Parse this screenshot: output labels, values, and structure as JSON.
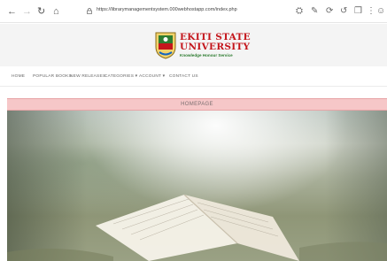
{
  "browser": {
    "url": "https://librarymanagementsystem.000webhostapp.com/index.php",
    "icons": [
      "back-icon",
      "forward-icon",
      "reload-icon",
      "home-icon",
      "lock-icon"
    ],
    "extension_icons": [
      "translate-icon",
      "pen-icon",
      "sync-icon",
      "history-icon",
      "collections-icon",
      "sidebar-icon",
      "profile-icon"
    ]
  },
  "header": {
    "university_line1": "EKITI STATE",
    "university_line2": "UNIVERSITY",
    "motto": "Knowledge Honour Service"
  },
  "menu": {
    "items": [
      "HOME",
      "POPULAR BOOKS",
      "NEW RELEASES",
      "CATEGORIES ▾",
      "ACCOUNT ▾",
      "CONTACT US"
    ]
  },
  "page": {
    "homepage_label": "HOMEPAGE"
  },
  "colors": {
    "accent_red": "#c4161c",
    "strip_pink": "#f6c7c8",
    "motto_green": "#2e7d32"
  }
}
